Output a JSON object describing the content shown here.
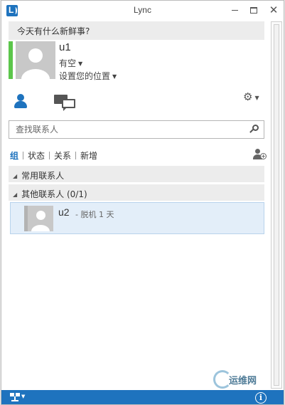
{
  "window": {
    "title": "Lync",
    "icons": {
      "app": "lync-logo-icon",
      "minimize": "minimize-icon",
      "maximize": "maximize-icon",
      "close": "close-icon"
    },
    "close_glyph": "✕"
  },
  "status_message": {
    "placeholder_text": "今天有什么新鲜事?"
  },
  "profile": {
    "name": "u1",
    "presence": "有空",
    "location": "设置您的位置",
    "presence_color": "#5cc64b"
  },
  "nav": {
    "icons": [
      "contacts-icon",
      "conversations-icon",
      "gear-icon"
    ],
    "settings_glyph": "⚙"
  },
  "search": {
    "placeholder": "查找联系人",
    "icon": "search-icon"
  },
  "tabs": [
    {
      "label": "组",
      "active": true
    },
    {
      "label": "状态",
      "active": false
    },
    {
      "label": "关系",
      "active": false
    },
    {
      "label": "新增",
      "active": false
    }
  ],
  "groups": [
    {
      "name": "常用联系人",
      "expanded": true
    },
    {
      "name": "其他联系人 (0/1)",
      "expanded": true
    }
  ],
  "contacts": [
    {
      "name": "u2",
      "status": "- 脱机 1 天",
      "presence_color": "#b3b3b3"
    }
  ],
  "watermark": {
    "text": "运维网"
  },
  "footer": {
    "info_glyph": "i"
  },
  "colors": {
    "accent": "#1e73be",
    "group_bg": "#ececec",
    "selected_row": "#e3eef9"
  }
}
